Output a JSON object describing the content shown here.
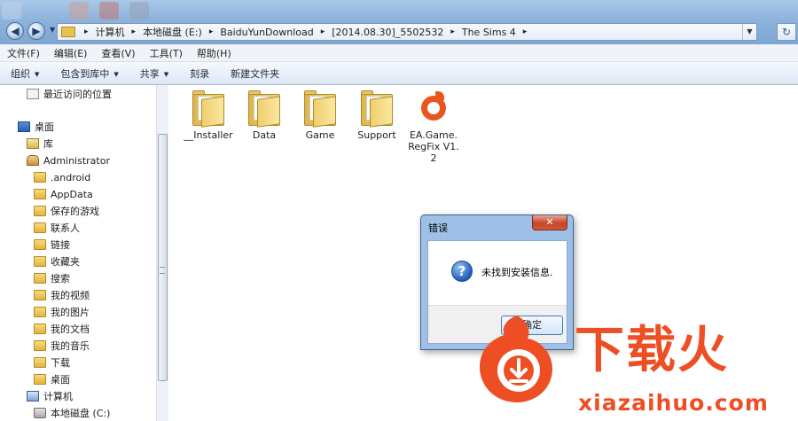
{
  "address_bar": {
    "crumbs": [
      "计算机",
      "本地磁盘 (E:)",
      "BaiduYunDownload",
      "[2014.08.30]_5502532",
      "The Sims 4"
    ]
  },
  "menu": {
    "items": [
      "文件(F)",
      "编辑(E)",
      "查看(V)",
      "工具(T)",
      "帮助(H)"
    ]
  },
  "toolbar": {
    "organize": "组织",
    "include_in_library": "包含到库中",
    "share": "共享",
    "burn": "刻录",
    "new_folder": "新建文件夹"
  },
  "nav_pane": {
    "items": [
      {
        "label": "最近访问的位置",
        "icon": "recent-places-icon"
      },
      {
        "label": "桌面",
        "icon": "desktop-icon"
      },
      {
        "label": "库",
        "icon": "library-icon"
      },
      {
        "label": "Administrator",
        "icon": "user-folder-icon"
      },
      {
        "label": ".android",
        "icon": "folder-icon"
      },
      {
        "label": "AppData",
        "icon": "folder-icon"
      },
      {
        "label": "保存的游戏",
        "icon": "folder-icon"
      },
      {
        "label": "联系人",
        "icon": "folder-icon"
      },
      {
        "label": "链接",
        "icon": "folder-icon"
      },
      {
        "label": "收藏夹",
        "icon": "folder-icon"
      },
      {
        "label": "搜索",
        "icon": "folder-icon"
      },
      {
        "label": "我的视频",
        "icon": "folder-icon"
      },
      {
        "label": "我的图片",
        "icon": "folder-icon"
      },
      {
        "label": "我的文档",
        "icon": "folder-icon"
      },
      {
        "label": "我的音乐",
        "icon": "folder-icon"
      },
      {
        "label": "下载",
        "icon": "folder-icon"
      },
      {
        "label": "桌面",
        "icon": "folder-icon"
      },
      {
        "label": "计算机",
        "icon": "computer-icon"
      },
      {
        "label": "本地磁盘 (C:)",
        "icon": "drive-icon"
      }
    ]
  },
  "files": [
    {
      "label": "__Installer",
      "type": "folder"
    },
    {
      "label": "Data",
      "type": "folder"
    },
    {
      "label": "Game",
      "type": "folder"
    },
    {
      "label": "Support",
      "type": "folder"
    },
    {
      "label": "EA.Game.RegFix V1.2",
      "type": "origin-app"
    }
  ],
  "dialog": {
    "title": "错误",
    "close": "✕",
    "message": "未找到安装信息.",
    "ok_label": "确定"
  },
  "watermark": {
    "text": "下载火",
    "domain": "xiazaihuo.com"
  },
  "colors": {
    "accent_orange": "#ee4e23",
    "title_blue": "#8db3db"
  }
}
